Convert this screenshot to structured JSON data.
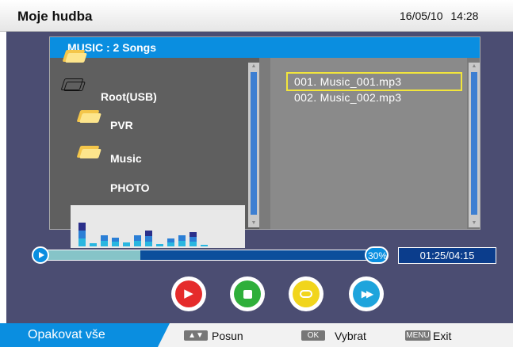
{
  "header": {
    "title": "Moje hudba",
    "date": "16/05/10",
    "time": "14:28"
  },
  "browser": {
    "title": "MUSIC : 2 Songs",
    "tree": [
      {
        "label": "Root(USB)",
        "icon": "folder-open-icon"
      },
      {
        "label": "PVR",
        "icon": "folder-icon"
      },
      {
        "label": "Music",
        "icon": "folder-icon"
      },
      {
        "label": "PHOTO",
        "icon": "folder-icon"
      }
    ],
    "files": [
      {
        "label": "001.  Music_001.mp3",
        "selected": true
      },
      {
        "label": "002.  Music_002.mp3",
        "selected": false
      }
    ]
  },
  "player": {
    "progress_percent": 30,
    "progress_label": "30%",
    "time": "01:25/04:15",
    "buttons": [
      {
        "name": "play-button",
        "icon": "play-icon",
        "color": "#e52b2b"
      },
      {
        "name": "stop-button",
        "icon": "stop-icon",
        "color": "#2faf3a"
      },
      {
        "name": "repeat-button",
        "icon": "repeat-icon",
        "color": "#f1d51c"
      },
      {
        "name": "fast-forward-button",
        "icon": "fast-forward-icon",
        "color": "#1ea4dc"
      }
    ]
  },
  "footer": {
    "mode": "Opakovat vše",
    "hints": [
      {
        "key": "▲▼",
        "label": "Posun"
      },
      {
        "key": "OK",
        "label": "Vybrat"
      },
      {
        "key": "MENU",
        "label": "Exit"
      }
    ]
  },
  "colors": {
    "accent": "#0a8ee0",
    "background": "#4b4d72",
    "selection": "#f2e53c"
  }
}
